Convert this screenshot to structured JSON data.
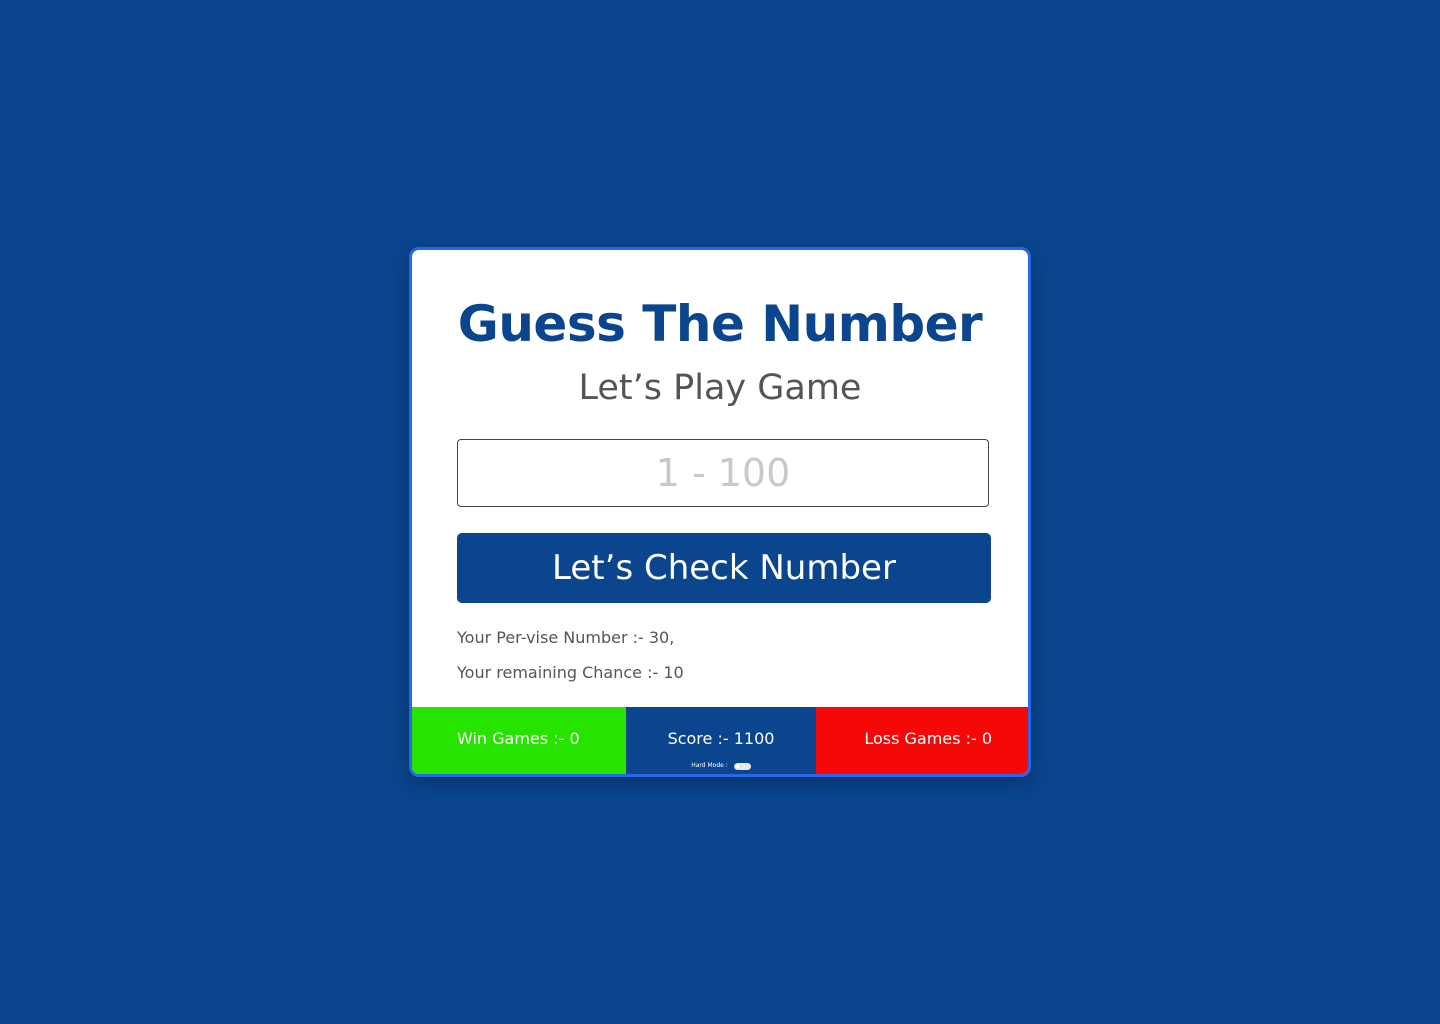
{
  "game": {
    "title": "Guess The Number",
    "subtitle": "Let’s Play Game"
  },
  "input": {
    "placeholder": "1 - 100",
    "value": ""
  },
  "check_button": {
    "label": "Let’s Check Number"
  },
  "info": {
    "previous_numbers": "Your Per-vise Number :- 30,",
    "remaining_chance": "Your remaining Chance :- 10"
  },
  "stats": {
    "win_label": "Win Games :- 0",
    "score_label": "Score :- 1100",
    "loss_label": "Loss Games :- 0",
    "hard_mode_label": "Hard Mode :",
    "hard_mode_enabled": false
  },
  "colors": {
    "background": "#0b458d",
    "primary": "#0b458d",
    "card_border": "#2668e6",
    "win": "#26e300",
    "loss": "#f50808",
    "text_muted": "#555555"
  }
}
